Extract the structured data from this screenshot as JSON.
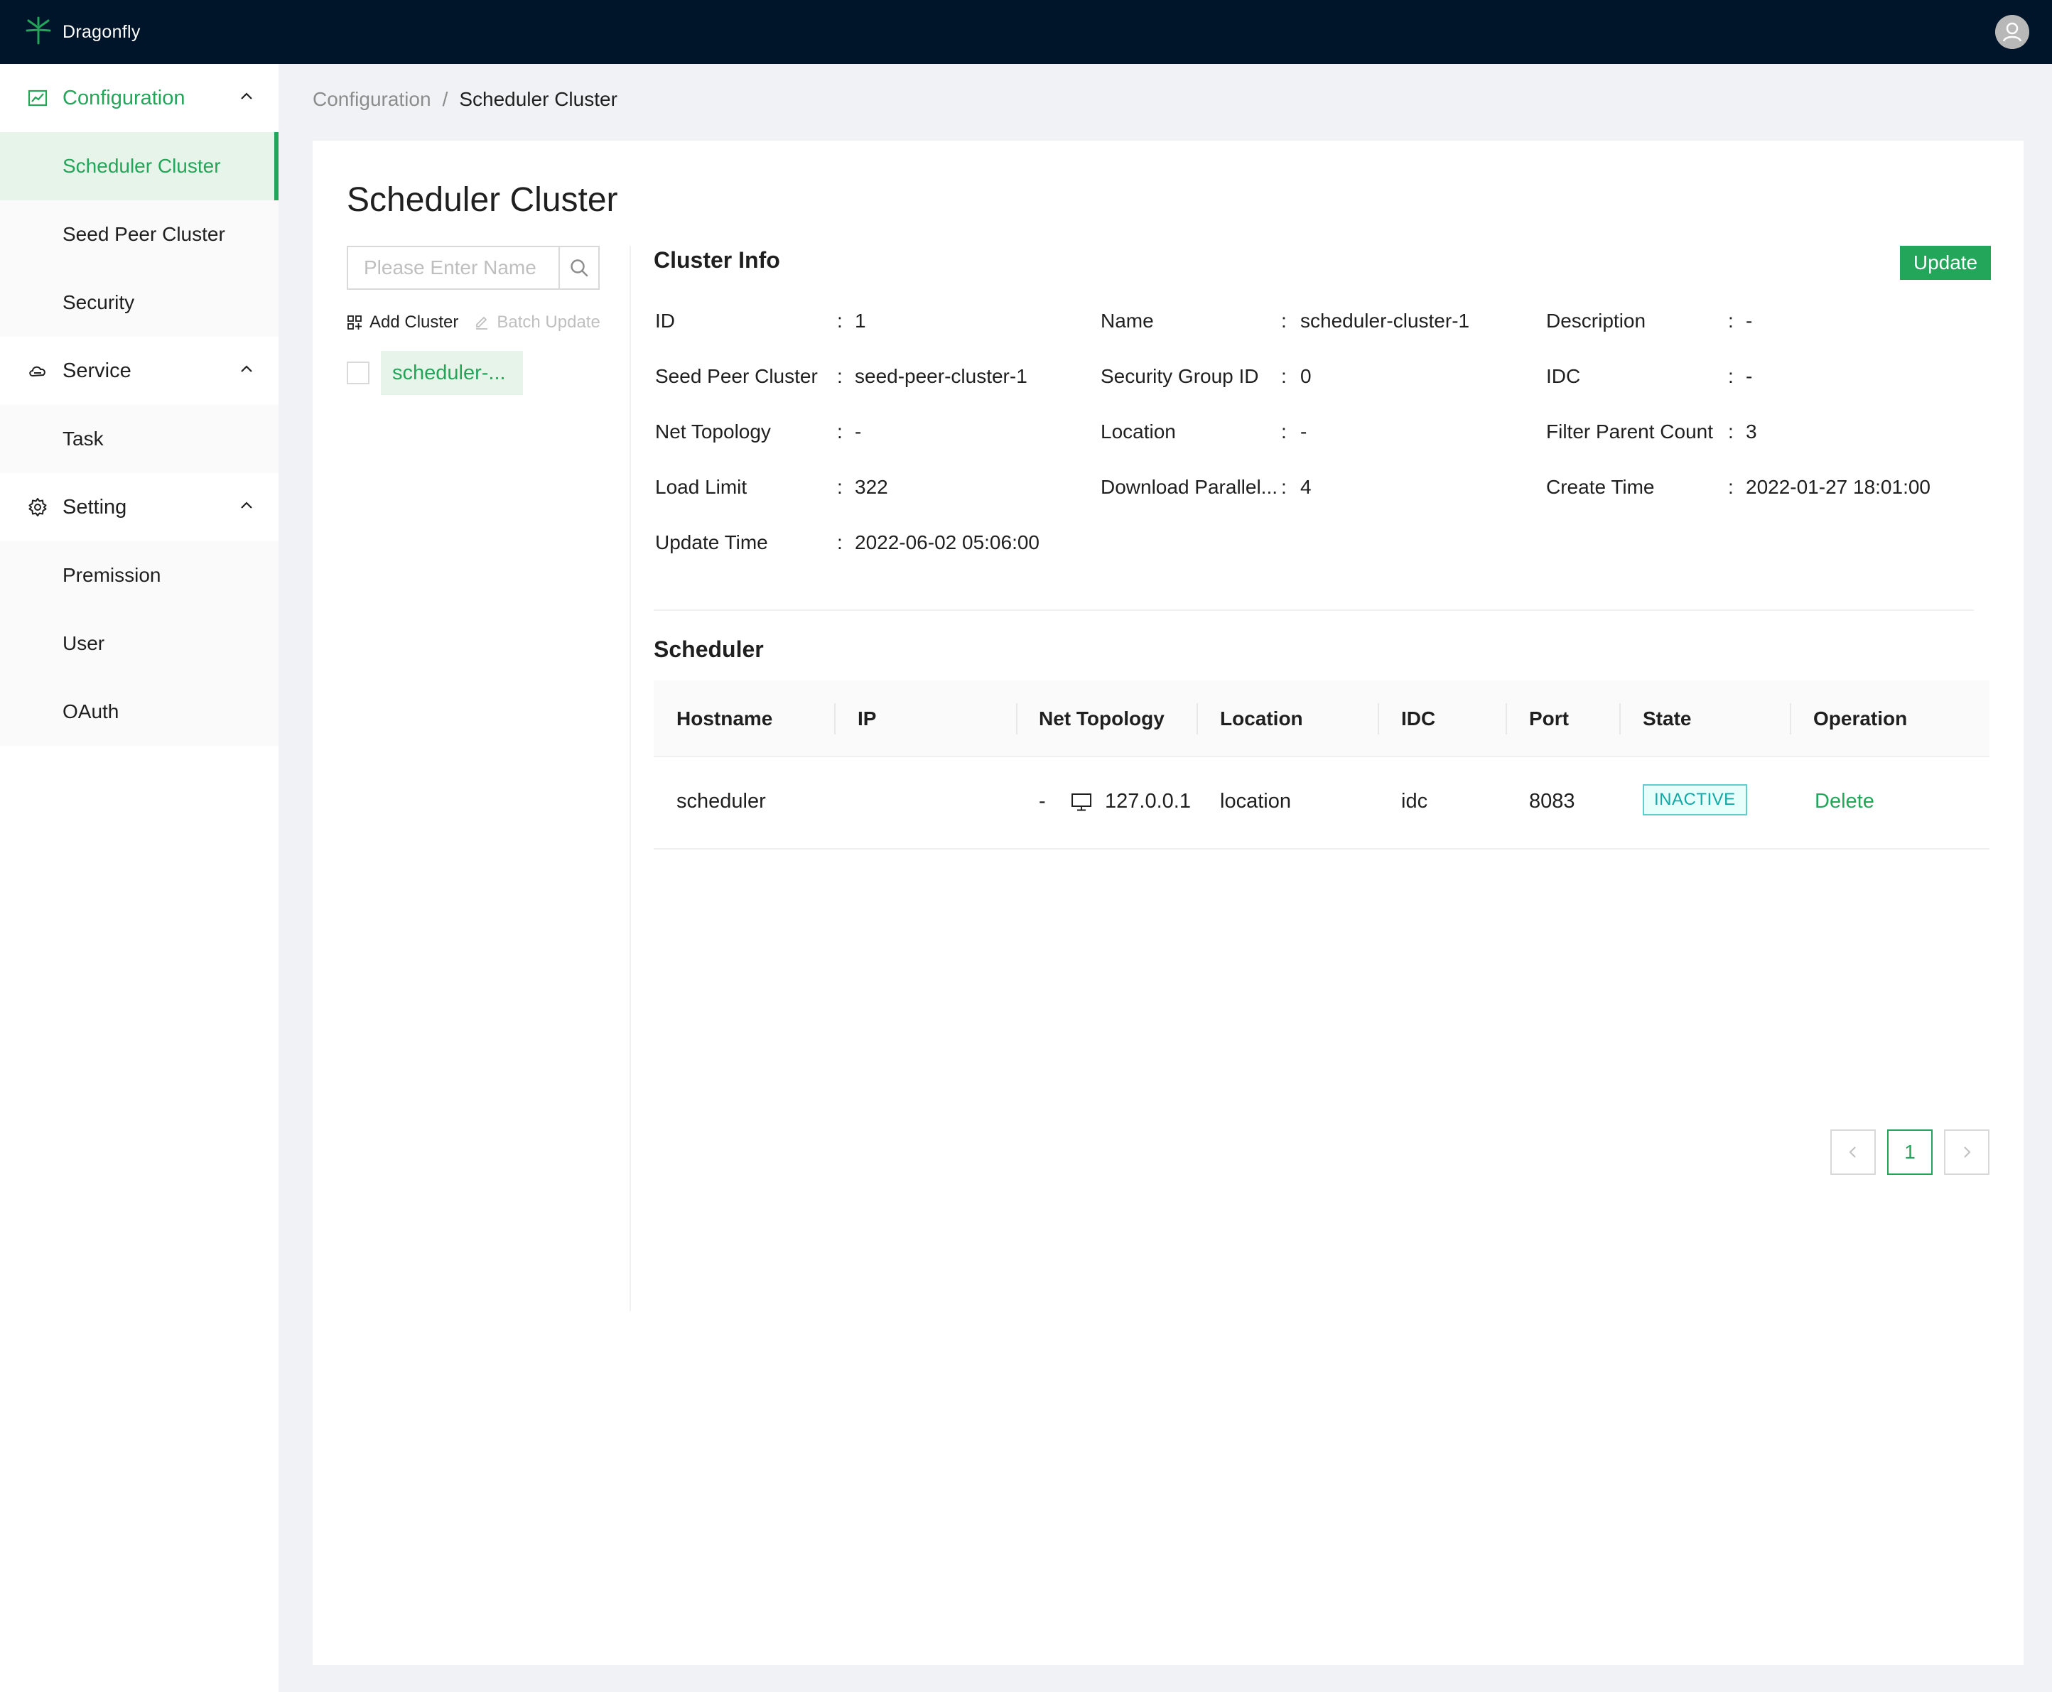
{
  "app": {
    "name": "Dragonfly"
  },
  "colors": {
    "brand": "#23a55a",
    "topbar": "#001529",
    "inactive": "#13a8a8"
  },
  "sidebar": {
    "groups": [
      {
        "label": "Configuration",
        "icon": "chart-icon",
        "expanded": true,
        "items": [
          {
            "label": "Scheduler Cluster",
            "selected": true
          },
          {
            "label": "Seed Peer Cluster"
          },
          {
            "label": "Security"
          }
        ]
      },
      {
        "label": "Service",
        "icon": "cloud-icon",
        "expanded": true,
        "items": [
          {
            "label": "Task"
          }
        ]
      },
      {
        "label": "Setting",
        "icon": "gear-icon",
        "expanded": true,
        "items": [
          {
            "label": "Premission"
          },
          {
            "label": "User"
          },
          {
            "label": "OAuth"
          }
        ]
      }
    ]
  },
  "breadcrumb": {
    "parent": "Configuration",
    "separator": "/",
    "current": "Scheduler Cluster"
  },
  "page": {
    "title": "Scheduler Cluster"
  },
  "cluster_list": {
    "search_placeholder": "Please Enter Name",
    "add_label": "Add Cluster",
    "batch_label": "Batch Update",
    "items": [
      {
        "name": "scheduler-..."
      }
    ]
  },
  "cluster_info": {
    "title": "Cluster Info",
    "update_label": "Update",
    "separator": ":",
    "fields": [
      {
        "key": "ID",
        "value": "1"
      },
      {
        "key": "Name",
        "value": "scheduler-cluster-1"
      },
      {
        "key": "Description",
        "value": "-"
      },
      {
        "key": "Seed Peer Cluster",
        "value": "seed-peer-cluster-1"
      },
      {
        "key": "Security Group ID",
        "value": "0"
      },
      {
        "key": "IDC",
        "value": "-"
      },
      {
        "key": "Net Topology",
        "value": "-"
      },
      {
        "key": "Location",
        "value": "-"
      },
      {
        "key": "Filter Parent Count",
        "value": "3"
      },
      {
        "key": "Load Limit",
        "value": "322"
      },
      {
        "key": "Download Parallel...",
        "value": "4"
      },
      {
        "key": "Create Time",
        "value": "2022-01-27 18:01:00"
      },
      {
        "key": "Update Time",
        "value": "2022-06-02 05:06:00"
      }
    ]
  },
  "scheduler": {
    "title": "Scheduler",
    "columns": [
      "Hostname",
      "IP",
      "Net Topology",
      "Location",
      "IDC",
      "Port",
      "State",
      "Operation"
    ],
    "rows": [
      {
        "hostname": "scheduler",
        "ip": "127.0.0.1",
        "net_topology": "-",
        "location": "location",
        "idc": "idc",
        "port": "8083",
        "state": "INACTIVE",
        "operation": "Delete"
      }
    ]
  },
  "pagination": {
    "current": "1"
  }
}
